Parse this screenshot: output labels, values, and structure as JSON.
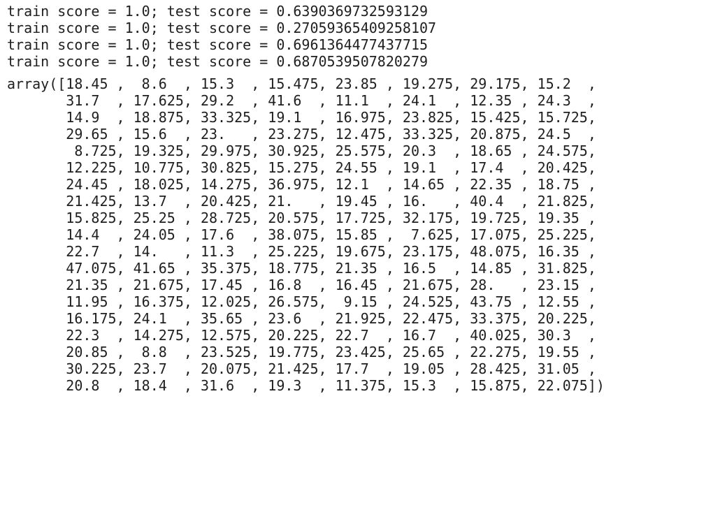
{
  "output": {
    "stream_lines": [
      "train score = 1.0; test score = 0.6390369732593129",
      "train score = 1.0; test score = 0.27059365409258107",
      "train score = 1.0; test score = 0.6961364477437715",
      "train score = 1.0; test score = 0.6870539507820279"
    ],
    "array_lines": [
      "array([18.45 ,  8.6  , 15.3  , 15.475, 23.85 , 19.275, 29.175, 15.2  ,",
      "       31.7  , 17.625, 29.2  , 41.6  , 11.1  , 24.1  , 12.35 , 24.3  ,",
      "       14.9  , 18.875, 33.325, 19.1  , 16.975, 23.825, 15.425, 15.725,",
      "       29.65 , 15.6  , 23.   , 23.275, 12.475, 33.325, 20.875, 24.5  ,",
      "        8.725, 19.325, 29.975, 30.925, 25.575, 20.3  , 18.65 , 24.575,",
      "       12.225, 10.775, 30.825, 15.275, 24.55 , 19.1  , 17.4  , 20.425,",
      "       24.45 , 18.025, 14.275, 36.975, 12.1  , 14.65 , 22.35 , 18.75 ,",
      "       21.425, 13.7  , 20.425, 21.   , 19.45 , 16.   , 40.4  , 21.825,",
      "       15.825, 25.25 , 28.725, 20.575, 17.725, 32.175, 19.725, 19.35 ,",
      "       14.4  , 24.05 , 17.6  , 38.075, 15.85 ,  7.625, 17.075, 25.225,",
      "       22.7  , 14.   , 11.3  , 25.225, 19.675, 23.175, 48.075, 16.35 ,",
      "       47.075, 41.65 , 35.375, 18.775, 21.35 , 16.5  , 14.85 , 31.825,",
      "       21.35 , 21.675, 17.45 , 16.8  , 16.45 , 21.675, 28.   , 23.15 ,",
      "       11.95 , 16.375, 12.025, 26.575,  9.15 , 24.525, 43.75 , 12.55 ,",
      "       16.175, 24.1  , 35.65 , 23.6  , 21.925, 22.475, 33.375, 20.225,",
      "       22.3  , 14.275, 12.575, 20.225, 22.7  , 16.7  , 40.025, 30.3  ,",
      "       20.85 ,  8.8  , 23.525, 19.775, 23.425, 25.65 , 22.275, 19.55 ,",
      "       30.225, 23.7  , 20.075, 21.425, 17.7  , 19.05 , 28.425, 31.05 ,",
      "       20.8  , 18.4  , 31.6  , 19.3  , 11.375, 15.3  , 15.875, 22.075])"
    ]
  }
}
